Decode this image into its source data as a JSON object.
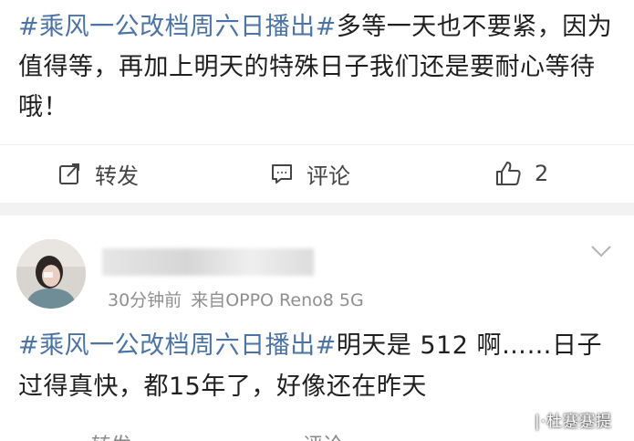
{
  "post1": {
    "hashtag": "#乘风一公改档周六日播出#",
    "body": "多等一天也不要紧，因为值得等，再加上明天的特殊日子我们还是要耐心等待哦！",
    "actions": {
      "repost": "转发",
      "comment": "评论",
      "like_count": "2"
    }
  },
  "post2": {
    "meta": {
      "time": "30分钟前",
      "source": "来自OPPO Reno8 5G"
    },
    "hashtag": "#乘风一公改档周六日播出#",
    "body": "明天是 512 啊……日子过得真快，都15年了，好像还在昨天",
    "actions": {
      "repost": "转发",
      "comment": "评论"
    }
  },
  "watermark": "|·杜蹇蹇提",
  "colors": {
    "hashtag": "#4a73a8",
    "text": "#1f1f1f",
    "meta": "#8f8f8f",
    "divider": "#f2f2f2"
  },
  "icons": [
    "repost-icon",
    "comment-icon",
    "like-icon",
    "chevron-down-icon"
  ]
}
